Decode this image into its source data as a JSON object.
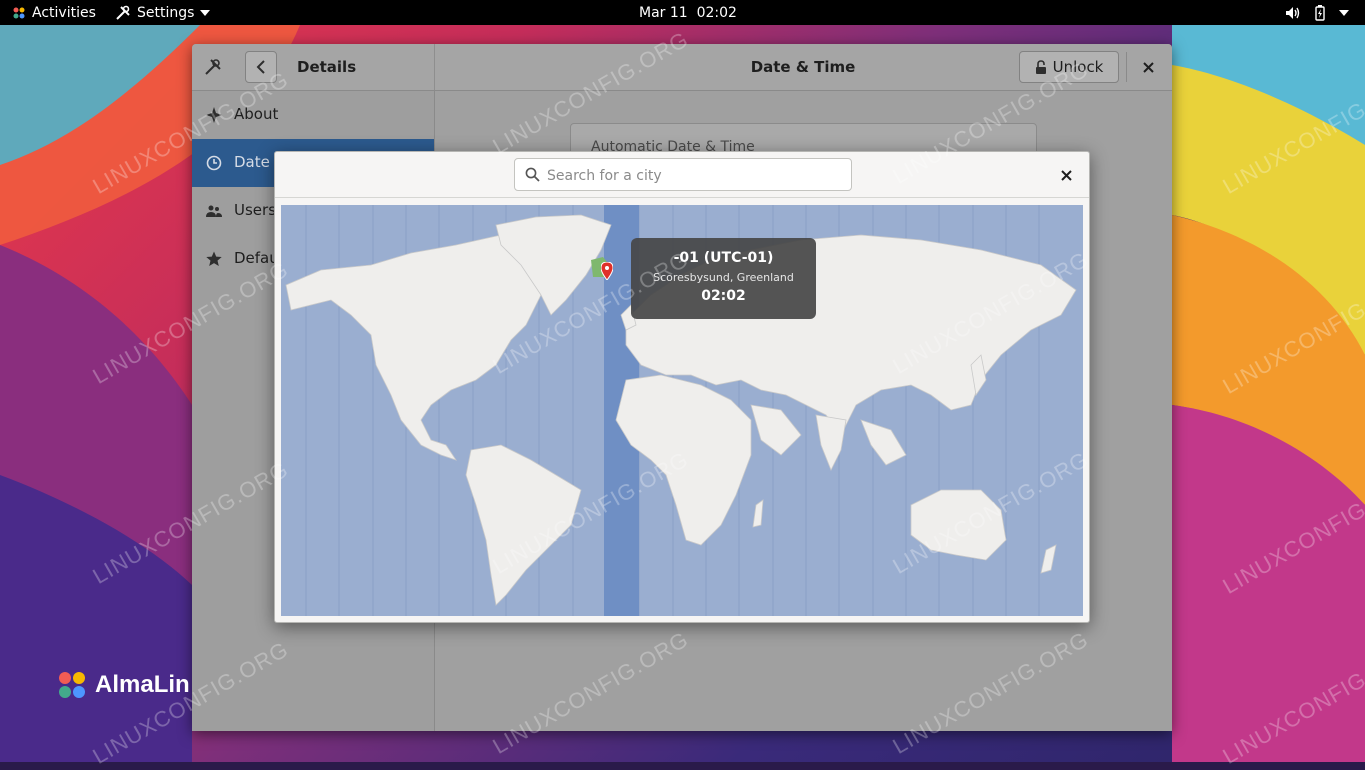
{
  "topbar": {
    "activities": "Activities",
    "app_menu": "Settings",
    "clock": "Mar 11  02:02",
    "icons": [
      "speaker-icon",
      "battery-icon",
      "power-menu-icon"
    ]
  },
  "window": {
    "sidebar_title": "Details",
    "page_title": "Date & Time",
    "unlock_label": "Unlock",
    "sidebar_items": [
      {
        "label": "About",
        "icon": "star-icon"
      },
      {
        "label": "Date &",
        "icon": "clock-icon",
        "active": true
      },
      {
        "label": "Users",
        "icon": "users-icon"
      },
      {
        "label": "Defau",
        "icon": "star-filled-icon"
      }
    ],
    "content_row": "Automatic Date & Time"
  },
  "dialog": {
    "search_placeholder": "Search for a city",
    "tooltip": {
      "offset": "-01 (UTC-01)",
      "city": "Scoresbysund, Greenland",
      "time": "02:02"
    }
  },
  "brand": {
    "name": "AlmaLin"
  },
  "watermark": "LINUXCONFIG.ORG",
  "colors": {
    "accent": "#2c5a8e",
    "map_ocean": "#9aaed0",
    "map_land": "#efeeec",
    "selected_zone": "#6f8fc4"
  }
}
